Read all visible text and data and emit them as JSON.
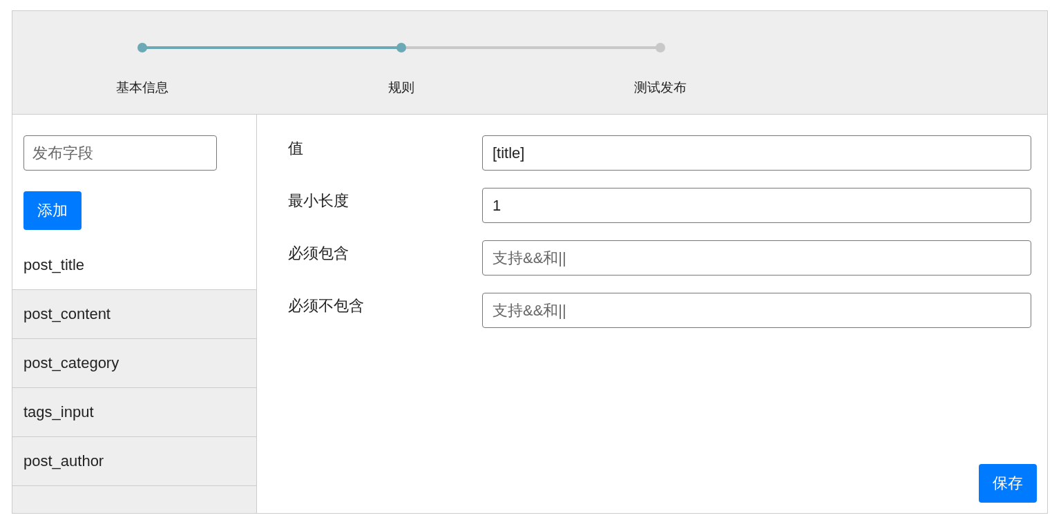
{
  "steps": [
    {
      "label": "基本信息",
      "reached": true
    },
    {
      "label": "规则",
      "reached": true
    },
    {
      "label": "测试发布",
      "reached": false
    }
  ],
  "sidebar": {
    "field": {
      "placeholder": "发布字段"
    },
    "add_button": "添加",
    "items": [
      {
        "label": "post_title",
        "selected": true
      },
      {
        "label": "post_content",
        "selected": false
      },
      {
        "label": "post_category",
        "selected": false
      },
      {
        "label": "tags_input",
        "selected": false
      },
      {
        "label": "post_author",
        "selected": false
      }
    ]
  },
  "form": {
    "fields": [
      {
        "label": "值",
        "value": "[title]"
      },
      {
        "label": "最小长度",
        "value": "1"
      },
      {
        "label": "必须包含",
        "placeholder": "支持&&和||"
      },
      {
        "label": "必须不包含",
        "placeholder": "支持&&和||"
      }
    ],
    "save_button": "保存"
  }
}
